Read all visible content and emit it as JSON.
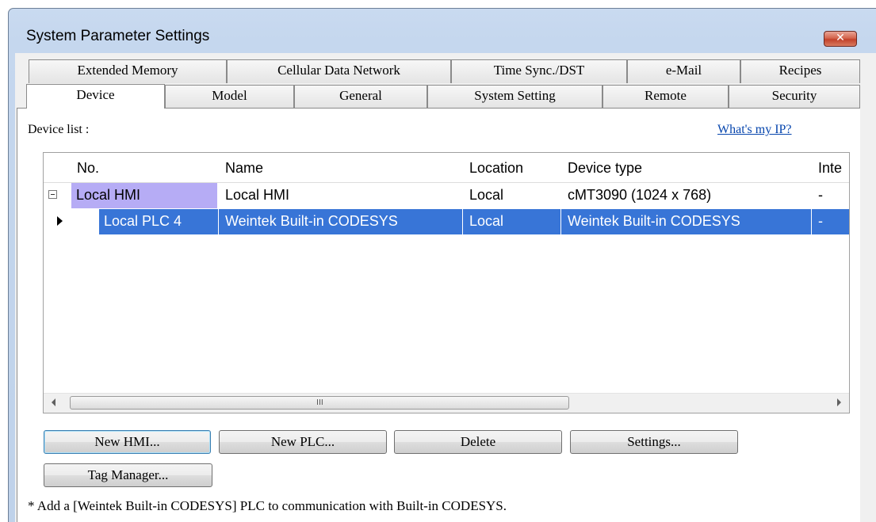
{
  "window": {
    "title": "System Parameter Settings",
    "close_glyph": "✕"
  },
  "tabs_back": [
    "Extended Memory",
    "Cellular Data Network",
    "Time Sync./DST",
    "e-Mail",
    "Recipes"
  ],
  "tabs_front": [
    "Device",
    "Model",
    "General",
    "System Setting",
    "Remote",
    "Security"
  ],
  "active_tab": "Device",
  "device_list": {
    "label": "Device list :",
    "ip_link": "What's my IP?",
    "columns": [
      "No.",
      "Name",
      "Location",
      "Device type",
      "Inte"
    ],
    "rows": [
      {
        "no": "Local HMI",
        "name": "Local HMI",
        "location": "Local",
        "type": "cMT3090 (1024 x 768)",
        "inte": "-"
      },
      {
        "no": "Local PLC 4",
        "name": "Weintek Built-in CODESYS",
        "location": "Local",
        "type": "Weintek Built-in CODESYS",
        "inte": "-"
      }
    ],
    "scroll_grip": "III"
  },
  "buttons": {
    "new_hmi": "New HMI...",
    "new_plc": "New PLC...",
    "delete": "Delete",
    "settings": "Settings...",
    "tag_manager": "Tag Manager..."
  },
  "note": "* Add a [Weintek Built-in CODESYS] PLC to communication with Built-in CODESYS.",
  "colors": {
    "selection": "#3875d7",
    "group_highlight": "#b6acf5",
    "link": "#0645ad"
  }
}
